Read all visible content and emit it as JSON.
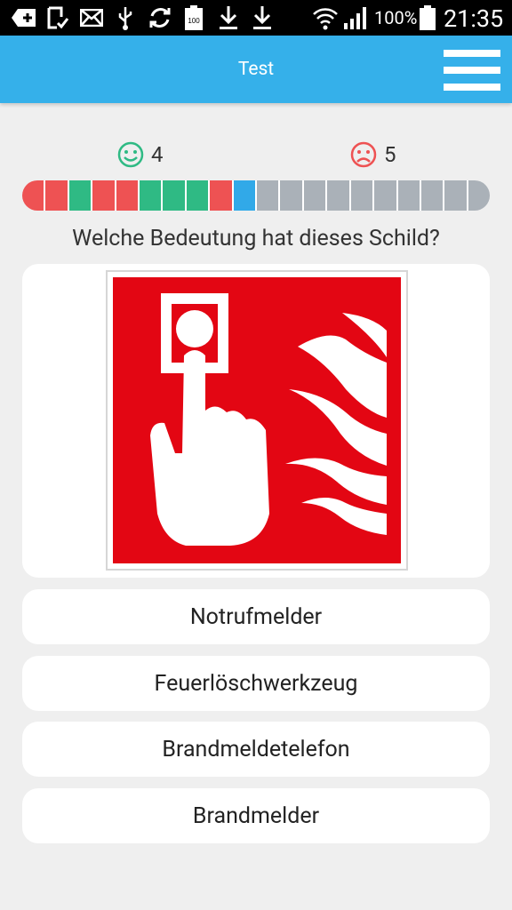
{
  "status_bar": {
    "battery_percent": "100%",
    "time": "21:35"
  },
  "app_bar": {
    "title": "Test"
  },
  "score": {
    "correct": "4",
    "wrong": "5"
  },
  "progress": {
    "segments": [
      "red",
      "red",
      "green",
      "red",
      "red",
      "green",
      "green",
      "green",
      "red",
      "blue",
      "gray",
      "gray",
      "gray",
      "gray",
      "gray",
      "gray",
      "gray",
      "gray",
      "gray",
      "gray"
    ]
  },
  "question": "Welche Bedeutung hat dieses Schild?",
  "answers": [
    "Notrufmelder",
    "Feuerlöschwerkzeug",
    "Brandmeldetelefon",
    "Brandmelder"
  ],
  "colors": {
    "accent": "#35b0ea",
    "correct": "#2fba84",
    "wrong": "#ee5253",
    "current": "#31a9e8",
    "pending": "#aab1b8",
    "sign_red": "#e30613"
  }
}
